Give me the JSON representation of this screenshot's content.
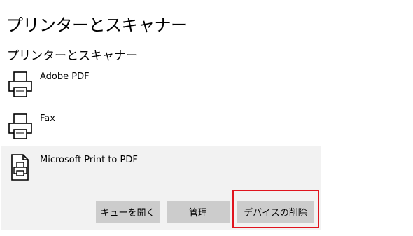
{
  "page": {
    "title": "プリンターとスキャナー",
    "section_title": "プリンターとスキャナー"
  },
  "devices": [
    {
      "name": "Adobe PDF",
      "icon": "printer-icon",
      "selected": false
    },
    {
      "name": "Fax",
      "icon": "printer-icon",
      "selected": false
    },
    {
      "name": "Microsoft Print to PDF",
      "icon": "printer-document-icon",
      "selected": true
    }
  ],
  "actions": {
    "open_queue": "キューを開く",
    "manage": "管理",
    "remove_device": "デバイスの削除"
  },
  "colors": {
    "selected_background": "#f2f2f2",
    "button_background": "#cccccc",
    "highlight_border": "#e0141e"
  }
}
